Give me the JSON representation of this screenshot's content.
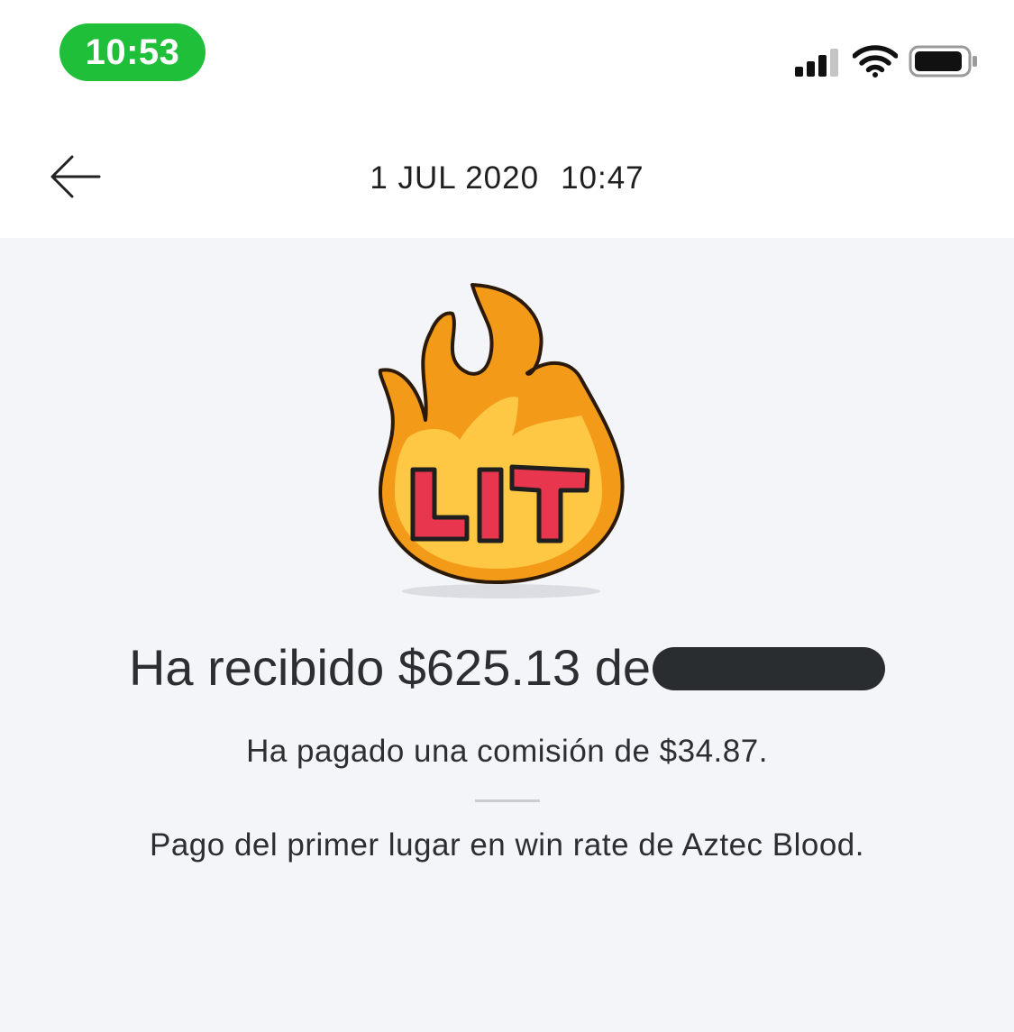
{
  "status_bar": {
    "time": "10:53",
    "icons": [
      "cellular-signal-icon",
      "wifi-icon",
      "battery-icon"
    ]
  },
  "header": {
    "back_icon": "arrow-left-icon",
    "date": "1 JUL 2020",
    "time": "10:47"
  },
  "sticker": {
    "icon": "lit-fire-sticker",
    "text": "LIT"
  },
  "transaction": {
    "headline": "Ha recibido $625.13 de",
    "fee": "Ha pagado una comisión de $34.87.",
    "note": "Pago del primer lugar en win rate de Aztec Blood."
  },
  "colors": {
    "time_pill": "#1fbf3a",
    "background": "#f4f5f8",
    "text": "#2c2e2f",
    "flame_outer": "#f39a18",
    "flame_inner": "#ffc844",
    "sticker_text": "#e8364f"
  }
}
